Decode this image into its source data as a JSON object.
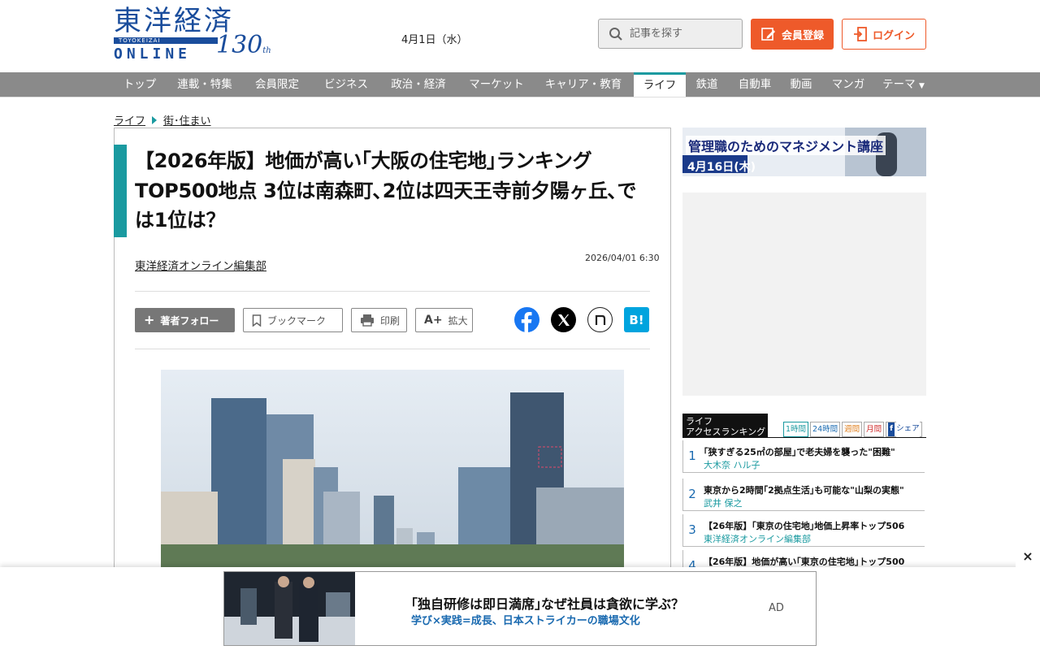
{
  "header": {
    "logo": {
      "kanji": "東洋経済",
      "sub": "TOYOKEIZAI",
      "online": "ONLINE",
      "anniv": "130",
      "anniv_suffix": "th"
    },
    "date": "4月1日（水）",
    "search_placeholder": "記事を探す",
    "register_label": "会員登録",
    "login_label": "ログイン"
  },
  "nav": {
    "items": [
      "トップ",
      "連載・特集",
      "会員限定",
      "ビジネス",
      "政治・経済",
      "マーケット",
      "キャリア・教育",
      "ライフ",
      "鉄道",
      "自動車",
      "動画",
      "マンガ",
      "テーマ"
    ],
    "active": "ライフ"
  },
  "breadcrumb": [
    "ライフ",
    "街･住まい"
  ],
  "article": {
    "title": "【2026年版】地価が高い｢大阪の住宅地｣ランキングTOP500地点 3位は南森町､2位は四天王寺前夕陽ヶ丘､では1位は？",
    "author": "東洋経済オンライン編集部",
    "date": "2026/04/01 6:30",
    "tools": {
      "follow": "著者フォロー",
      "bookmark": "ブックマーク",
      "print": "印刷",
      "zoom": "拡大"
    },
    "share": {
      "hatena": "B!"
    }
  },
  "sidebar": {
    "banner": {
      "text": "管理職のためのマネジメント講座",
      "date": "4月16日(木)"
    },
    "ranking": {
      "heading_line1": "ライフ",
      "heading_line2": "アクセスランキング",
      "tabs": [
        "1時間",
        "24時間",
        "週間",
        "月間",
        "シェア"
      ],
      "items": [
        {
          "num": "1",
          "title": "｢狭すぎる25㎡の部屋｣で老夫婦を襲った\"困難\"",
          "author": "大木奈 ハル子"
        },
        {
          "num": "2",
          "title": "東京から2時間｢2拠点生活｣も可能な\"山梨の実態\"",
          "author": "武井 保之"
        },
        {
          "num": "3",
          "title": "【26年版】｢東京の住宅地｣地価上昇率トップ506",
          "author": "東洋経済オンライン編集部"
        },
        {
          "num": "4",
          "title": "【26年版】地価が高い｢東京の住宅地｣トップ500",
          "author": ""
        }
      ]
    }
  },
  "bottom_ad": {
    "headline": "｢独自研修は即日満席｣なぜ社員は貪欲に学ぶ？",
    "subline": "学び×実践=成長、日本ストライカーの職場文化",
    "label": "AD",
    "close": "×"
  },
  "colors": {
    "accent": "#1a9aa0",
    "brand": "#1a4d9c",
    "cta": "#ee5a2a",
    "nav_bg": "#8a8a8a"
  }
}
